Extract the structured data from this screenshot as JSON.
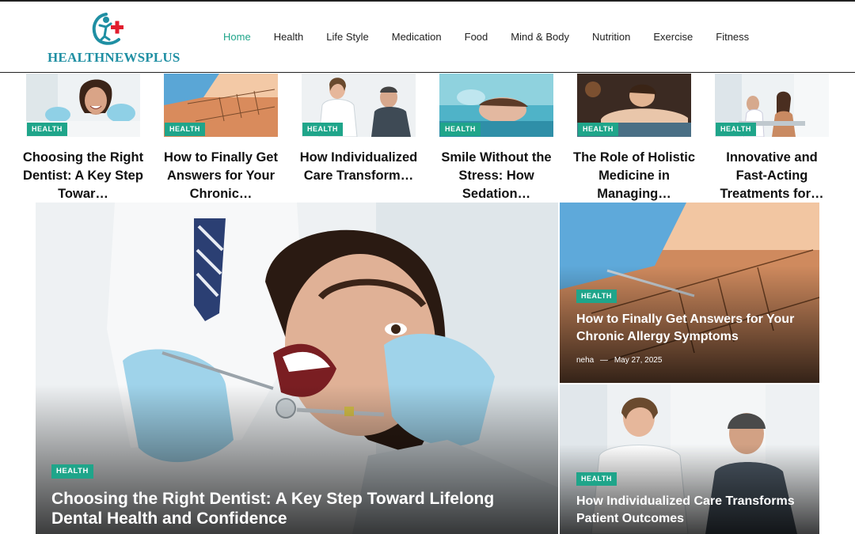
{
  "brand": {
    "name": "HEALTHNEWSPLUS",
    "primary": "#1f8fa3",
    "accent": "#1fa58a",
    "cross": "#e11d2e"
  },
  "nav": {
    "items": [
      "Home",
      "Health",
      "Life Style",
      "Medication",
      "Food",
      "Mind & Body",
      "Nutrition",
      "Exercise",
      "Fitness"
    ],
    "active": "Home"
  },
  "strip": {
    "cards": [
      {
        "category": "HEALTH",
        "title": "Choosing the Right Dentist: A Key Step Towar…"
      },
      {
        "category": "HEALTH",
        "title": "How to Finally Get Answers for Your Chronic…"
      },
      {
        "category": "HEALTH",
        "title": "How Individualized Care Transform…"
      },
      {
        "category": "HEALTH",
        "title": "Smile Without the Stress: How Sedation…"
      },
      {
        "category": "HEALTH",
        "title": "The Role of Holistic Medicine in Managing…"
      },
      {
        "category": "HEALTH",
        "title": "Innovative and Fast-Acting Treatments for…"
      }
    ]
  },
  "hero": {
    "category": "HEALTH",
    "title": "Choosing the Right Dentist: A Key Step Toward Lifelong Dental Health and Confidence"
  },
  "side": [
    {
      "category": "HEALTH",
      "title": "How to Finally Get Answers for Your Chronic Allergy Symptoms",
      "author": "neha",
      "separator": "—",
      "date": "May 27, 2025"
    },
    {
      "category": "HEALTH",
      "title": "How Individualized Care Transforms Patient Outcomes"
    }
  ],
  "icons": {
    "logo": "figure-with-medical-cross-icon"
  }
}
